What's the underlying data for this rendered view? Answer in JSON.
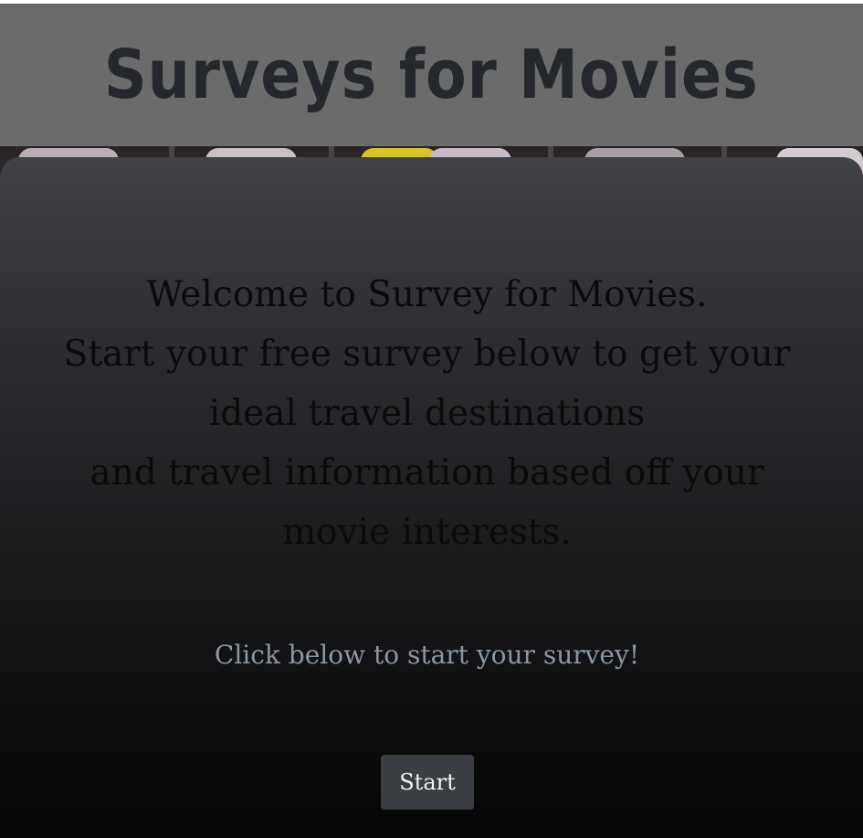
{
  "header": {
    "title": "Surveys for Movies"
  },
  "intro": {
    "lines": [
      "Welcome to Survey for Movies.",
      "Start your free survey below to get your",
      "ideal travel destinations",
      "and travel information based off your",
      "movie interests."
    ]
  },
  "cta": {
    "text": "Click below to start your survey!"
  },
  "start_button": {
    "label": "Start"
  },
  "colors": {
    "header_bg": "#6b6b6b",
    "title_text": "#24272c",
    "cta_text": "#8a97a3",
    "button_bg": "#3a3e44"
  }
}
